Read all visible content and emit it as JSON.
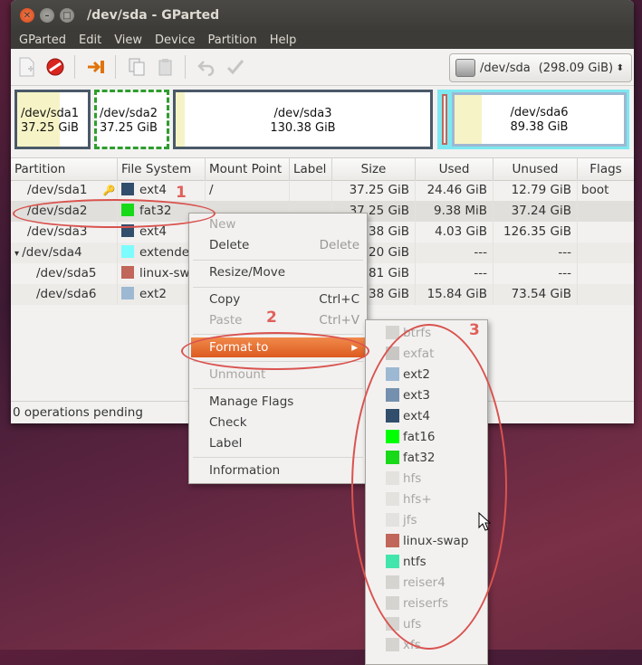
{
  "window": {
    "title": "/dev/sda - GParted"
  },
  "menu": [
    "GParted",
    "Edit",
    "View",
    "Device",
    "Partition",
    "Help"
  ],
  "toolbar": {
    "device": "/dev/sda",
    "device_size": "(298.09 GiB)"
  },
  "graph": [
    {
      "name": "/dev/sda1",
      "size": "37.25 GiB"
    },
    {
      "name": "/dev/sda2",
      "size": "37.25 GiB"
    },
    {
      "name": "/dev/sda3",
      "size": "130.38 GiB"
    },
    {
      "name": "/dev/sda6",
      "size": "89.38 GiB"
    }
  ],
  "columns": [
    "Partition",
    "File System",
    "Mount Point",
    "Label",
    "Size",
    "Used",
    "Unused",
    "Flags"
  ],
  "rows": [
    {
      "partition": "/dev/sda1",
      "fs": "ext4",
      "fscolor": "#314e6c",
      "mount": "/",
      "size": "37.25 GiB",
      "used": "24.46 GiB",
      "unused": "12.79 GiB",
      "flags": "boot"
    },
    {
      "partition": "/dev/sda2",
      "fs": "fat32",
      "fscolor": "#18d918",
      "mount": "",
      "size": "37.25 GiB",
      "used": "9.38 MiB",
      "unused": "37.24 GiB",
      "flags": ""
    },
    {
      "partition": "/dev/sda3",
      "fs": "ext4",
      "fscolor": "#314e6c",
      "mount": "",
      "size": "0.38 GiB",
      "used": "4.03 GiB",
      "unused": "126.35 GiB",
      "flags": ""
    },
    {
      "partition": "/dev/sda4",
      "fs": "extende",
      "fscolor": "#7dfcfe",
      "mount": "",
      "size": "3.20 GiB",
      "used": "---",
      "unused": "---",
      "flags": ""
    },
    {
      "partition": "/dev/sda5",
      "fs": "linux-swa",
      "fscolor": "#c1665a",
      "mount": "",
      "size": "3.81 GiB",
      "used": "---",
      "unused": "---",
      "flags": ""
    },
    {
      "partition": "/dev/sda6",
      "fs": "ext2",
      "fscolor": "#9db8d2",
      "mount": "",
      "size": "9.38 GiB",
      "used": "15.84 GiB",
      "unused": "73.54 GiB",
      "flags": ""
    }
  ],
  "status": "0 operations pending",
  "context_menu": [
    {
      "label": "New",
      "accel": "",
      "disabled": true
    },
    {
      "label": "Delete",
      "accel": "Delete",
      "disabled": false
    },
    {
      "label": "Resize/Move",
      "accel": "",
      "disabled": false
    },
    {
      "label": "Copy",
      "accel": "Ctrl+C",
      "disabled": false
    },
    {
      "label": "Paste",
      "accel": "Ctrl+V",
      "disabled": true
    },
    {
      "label": "Format to",
      "accel": "",
      "disabled": false
    },
    {
      "label": "Unmount",
      "accel": "",
      "disabled": true
    },
    {
      "label": "Manage Flags",
      "accel": "",
      "disabled": false
    },
    {
      "label": "Check",
      "accel": "",
      "disabled": false
    },
    {
      "label": "Label",
      "accel": "",
      "disabled": false
    },
    {
      "label": "Information",
      "accel": "",
      "disabled": false
    }
  ],
  "format_submenu": [
    {
      "label": "btrfs",
      "color": "#d6d4d0",
      "disabled": true
    },
    {
      "label": "exfat",
      "color": "#c9c7c3",
      "disabled": true
    },
    {
      "label": "ext2",
      "color": "#9db8d2",
      "disabled": false
    },
    {
      "label": "ext3",
      "color": "#7590ae",
      "disabled": false
    },
    {
      "label": "ext4",
      "color": "#314e6c",
      "disabled": false
    },
    {
      "label": "fat16",
      "color": "#00ff00",
      "disabled": false
    },
    {
      "label": "fat32",
      "color": "#18d918",
      "disabled": false
    },
    {
      "label": "hfs",
      "color": "#e4e2de",
      "disabled": true
    },
    {
      "label": "hfs+",
      "color": "#e4e2de",
      "disabled": true
    },
    {
      "label": "jfs",
      "color": "#e4e2de",
      "disabled": true
    },
    {
      "label": "linux-swap",
      "color": "#c1665a",
      "disabled": false
    },
    {
      "label": "ntfs",
      "color": "#42e5ac",
      "disabled": false
    },
    {
      "label": "reiser4",
      "color": "#d6d4d0",
      "disabled": true
    },
    {
      "label": "reiserfs",
      "color": "#d6d4d0",
      "disabled": true
    },
    {
      "label": "ufs",
      "color": "#d6d4d0",
      "disabled": true
    },
    {
      "label": "xfs",
      "color": "#d6d4d0",
      "disabled": true
    }
  ],
  "annotations": [
    "1",
    "2",
    "3"
  ]
}
